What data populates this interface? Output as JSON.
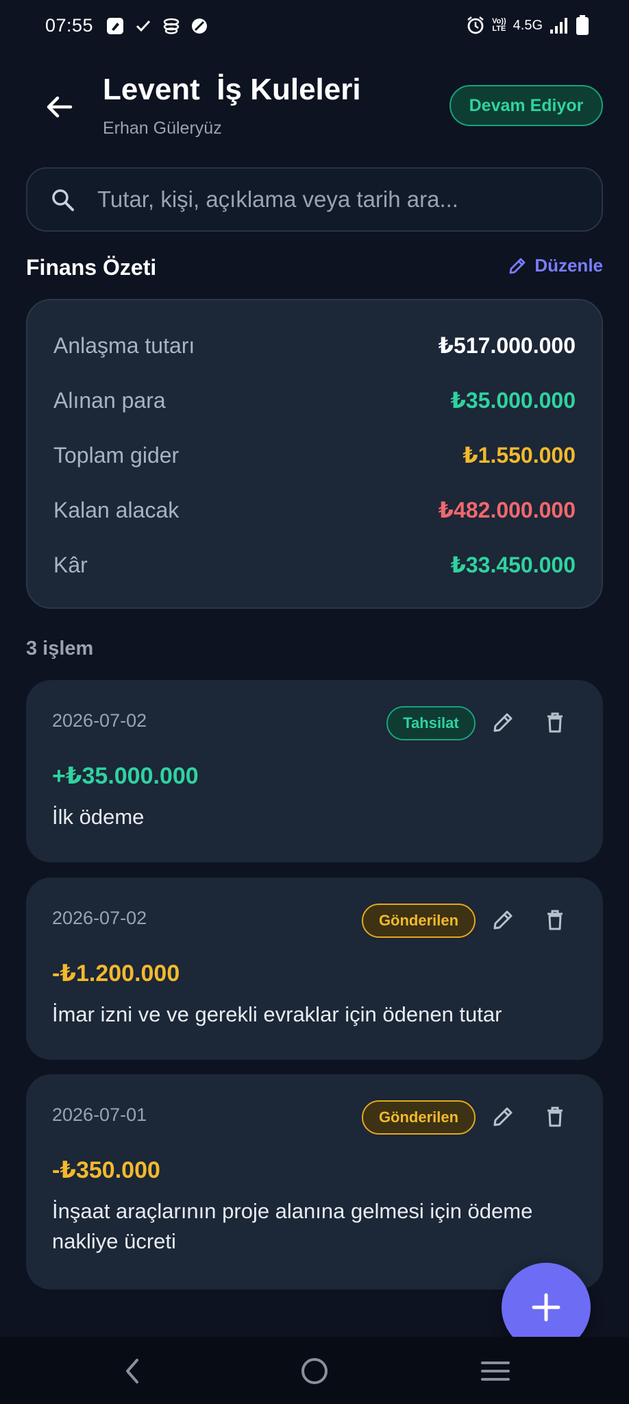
{
  "status_bar": {
    "time": "07:55",
    "network": "4.5G",
    "volte_top": "Vo))",
    "volte_bottom": "LTE",
    "icons": [
      "edit-square-icon",
      "check-icon",
      "app-stack-icon",
      "blocked-icon",
      "alarm-icon",
      "signal-icon",
      "battery-icon"
    ]
  },
  "header": {
    "title": "Levent  İş Kuleleri",
    "subtitle": "Erhan Güleryüz",
    "status": "Devam Ediyor"
  },
  "search": {
    "placeholder": "Tutar, kişi, açıklama veya tarih ara..."
  },
  "summary": {
    "title": "Finans Özeti",
    "edit_label": "Düzenle",
    "rows": [
      {
        "label": "Anlaşma tutarı",
        "value": "₺517.000.000",
        "color": "#ffffff"
      },
      {
        "label": "Alınan para",
        "value": "₺35.000.000",
        "color": "#2fd3a0"
      },
      {
        "label": "Toplam gider",
        "value": "₺1.550.000",
        "color": "#f4b92c"
      },
      {
        "label": "Kalan alacak",
        "value": "₺482.000.000",
        "color": "#f2686d"
      },
      {
        "label": "Kâr",
        "value": "₺33.450.000",
        "color": "#2fd3a0"
      }
    ]
  },
  "transactions": {
    "count_label": "3 işlem",
    "items": [
      {
        "date": "2026-07-02",
        "badge": "Tahsilat",
        "badge_type": "green",
        "amount": "+₺35.000.000",
        "amount_color": "#2fd3a0",
        "description": "İlk ödeme"
      },
      {
        "date": "2026-07-02",
        "badge": "Gönderilen",
        "badge_type": "yellow",
        "amount": "-₺1.200.000",
        "amount_color": "#f4b92c",
        "description": "İmar izni ve ve gerekli evraklar için ödenen tutar"
      },
      {
        "date": "2026-07-01",
        "badge": "Gönderilen",
        "badge_type": "yellow",
        "amount": "-₺350.000",
        "amount_color": "#f4b92c",
        "description": "İnşaat araçlarının proje alanına gelmesi için ödeme nakliye ücreti"
      }
    ]
  },
  "colors": {
    "background": "#0d1320",
    "card": "#1c2737",
    "accent": "#6d6cf4",
    "green": "#2fd3a0",
    "yellow": "#f4b92c",
    "red": "#f2686d"
  }
}
